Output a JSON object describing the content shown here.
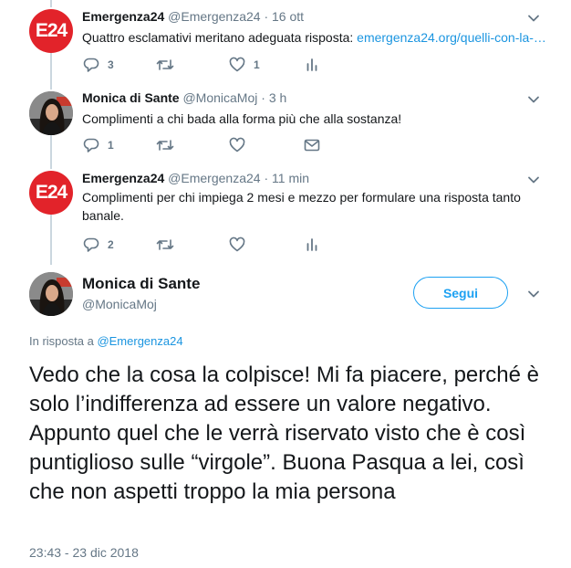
{
  "tweets": [
    {
      "avatar_text": "E24",
      "name": "Emergenza24",
      "handle": "@Emergenza24",
      "time": "16 ott",
      "text": "Quattro esclamativi meritano adeguata risposta: ",
      "link": "emergenza24.org/quelli-con-la-…",
      "reply_count": "3",
      "like_count": "1"
    },
    {
      "name": "Monica di Sante",
      "handle": "@MonicaMoj",
      "time": "3 h",
      "text": "Complimenti a chi bada alla forma più che alla sostanza!",
      "reply_count": "1"
    },
    {
      "avatar_text": "E24",
      "name": "Emergenza24",
      "handle": "@Emergenza24",
      "time": "11 min",
      "text": "Complimenti per chi impiega 2 mesi e mezzo per formulare una risposta tanto banale.",
      "reply_count": "2"
    }
  ],
  "separator": "·",
  "main": {
    "name": "Monica di Sante",
    "handle": "@MonicaMoj",
    "follow_label": "Segui",
    "reply_prefix": "In risposta a ",
    "reply_handle": "@Emergenza24",
    "text": "Vedo che la cosa la colpisce! Mi fa piacere, perché è solo l’indifferenza ad essere un valore negativo. Appunto quel che le verrà riservato visto che è così puntiglioso sulle “virgole”. Buona Pasqua a lei, così che non aspetti troppo la mia persona",
    "timestamp": "23:43 - 23 dic 2018"
  },
  "colors": {
    "accent": "#1da1f2",
    "link": "#1b95e0",
    "e24_red": "#e2232a",
    "muted": "#657786"
  },
  "icons": [
    "chevron-down-icon",
    "reply-icon",
    "retweet-icon",
    "heart-icon",
    "analytics-icon",
    "message-icon"
  ]
}
